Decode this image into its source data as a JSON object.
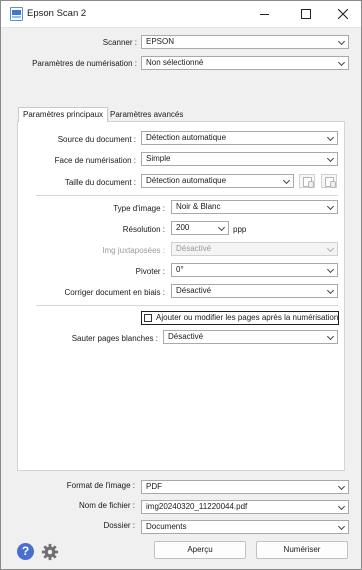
{
  "window": {
    "title": "Epson Scan 2",
    "controls": {
      "minimize": "minimize-icon",
      "maximize": "maximize-icon",
      "close": "close-icon"
    }
  },
  "scanner": {
    "label": "Scanner :",
    "value": "EPSON"
  },
  "scan_settings": {
    "label": "Paramètres de numérisation :",
    "value": "Non sélectionné"
  },
  "tabs": [
    {
      "label": "Paramètres principaux",
      "active": true
    },
    {
      "label": "Paramètres avancés",
      "active": false
    }
  ],
  "main": {
    "document_source": {
      "label": "Source du document :",
      "value": "Détection automatique"
    },
    "scan_side": {
      "label": "Face de numérisation :",
      "value": "Simple"
    },
    "document_size": {
      "label": "Taille du document :",
      "value": "Détection automatique"
    },
    "image_type": {
      "label": "Type d'image :",
      "value": "Noir & Blanc"
    },
    "resolution": {
      "label": "Résolution :",
      "value": "200",
      "unit": "ppp"
    },
    "stitch_images": {
      "label": "Img juxtaposées :",
      "value": "Désactivé",
      "disabled": true
    },
    "rotate": {
      "label": "Pivoter :",
      "value": "0°"
    },
    "correct_skew": {
      "label": "Corriger document en biais :",
      "value": "Désactivé"
    },
    "add_edit_pages": {
      "label": "Ajouter ou modifier les pages après la numérisation",
      "checked": false
    },
    "skip_blank_pages": {
      "label": "Sauter pages blanches :",
      "value": "Désactivé"
    }
  },
  "output": {
    "image_format": {
      "label": "Format de l'image :",
      "value": "PDF"
    },
    "file_name": {
      "label": "Nom de fichier :",
      "value": "img20240320_11220044.pdf"
    },
    "folder": {
      "label": "Dossier :",
      "value": "Documents"
    }
  },
  "buttons": {
    "preview": "Aperçu",
    "scan": "Numériser"
  },
  "colors": {
    "help_icon": "#4a6fcf",
    "accent_border": "#1f1f1f"
  }
}
